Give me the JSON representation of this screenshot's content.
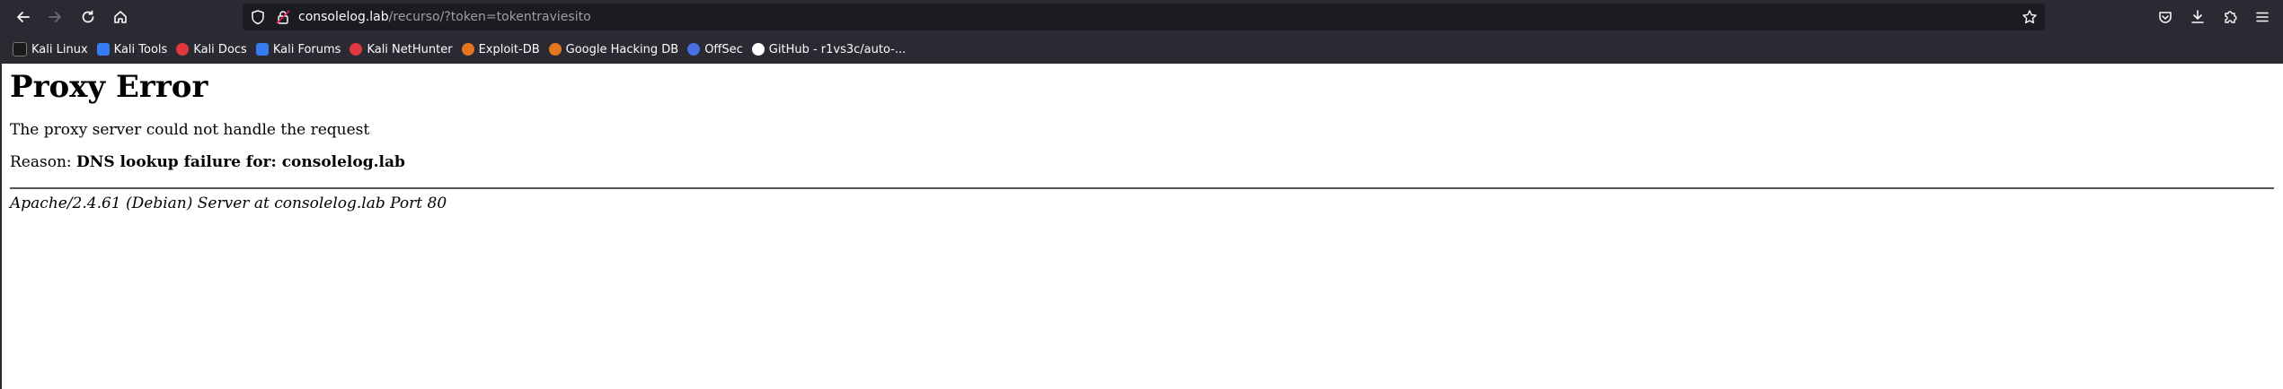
{
  "browser": {
    "url_host": "consolelog.lab",
    "url_path": "/recurso/?token=tokentraviesito"
  },
  "bookmarks": [
    {
      "label": "Kali Linux",
      "icon": "kali-dragon-icon",
      "color": "#1a1a1a"
    },
    {
      "label": "Kali Tools",
      "icon": "kali-tools-icon",
      "color": "#367bf0"
    },
    {
      "label": "Kali Docs",
      "icon": "kali-docs-icon",
      "color": "#e0383e"
    },
    {
      "label": "Kali Forums",
      "icon": "kali-forums-icon",
      "color": "#367bf0"
    },
    {
      "label": "Kali NetHunter",
      "icon": "nethunter-icon",
      "color": "#e0383e"
    },
    {
      "label": "Exploit-DB",
      "icon": "exploit-db-icon",
      "color": "#e5761f"
    },
    {
      "label": "Google Hacking DB",
      "icon": "ghdb-icon",
      "color": "#e5761f"
    },
    {
      "label": "OffSec",
      "icon": "offsec-icon",
      "color": "#4a6fe0"
    },
    {
      "label": "GitHub - r1vs3c/auto-...",
      "icon": "github-icon",
      "color": "#ffffff"
    }
  ],
  "page": {
    "heading": "Proxy Error",
    "message": "The proxy server could not handle the request",
    "reason_label": "Reason: ",
    "reason_value": "DNS lookup failure for: consolelog.lab",
    "footer": "Apache/2.4.61 (Debian) Server at consolelog.lab Port 80"
  }
}
